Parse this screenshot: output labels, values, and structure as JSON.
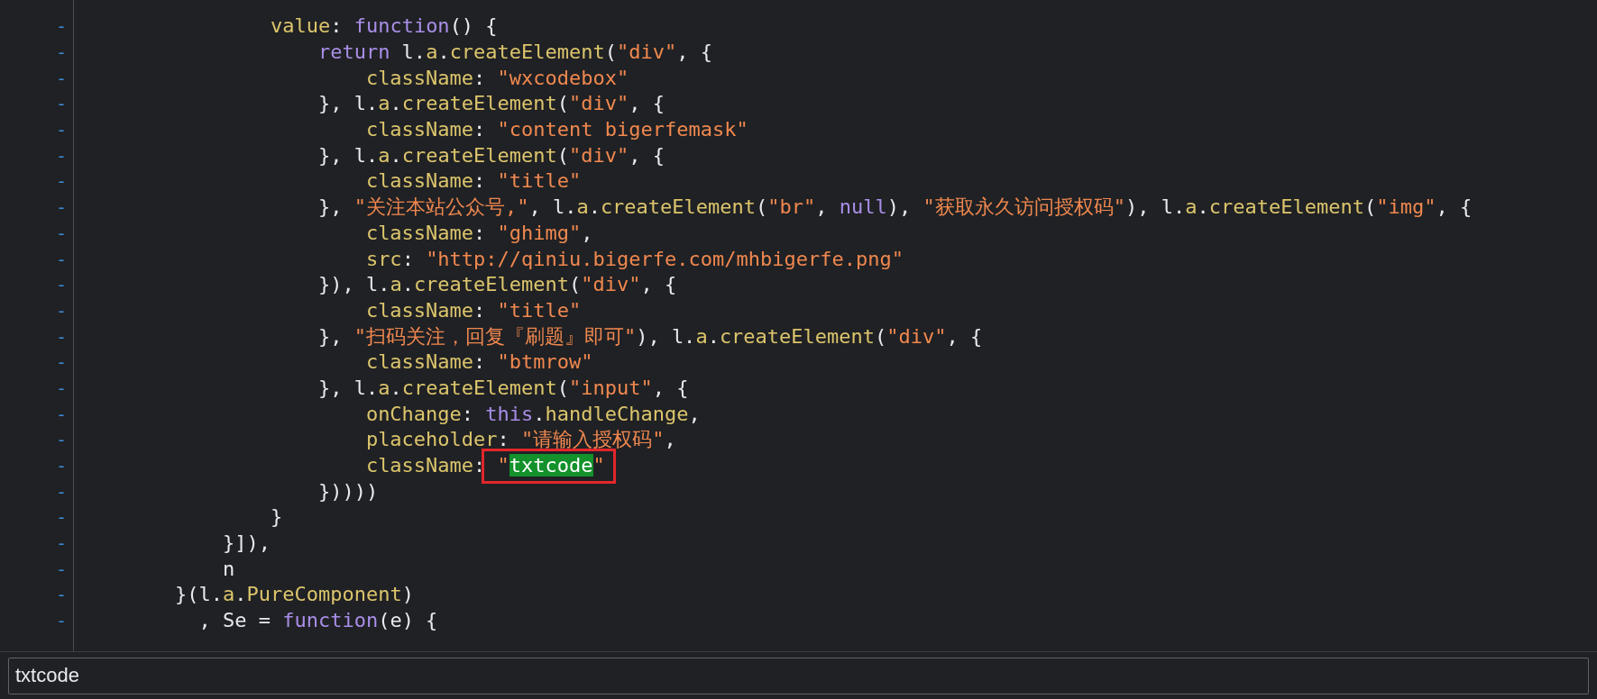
{
  "code_lines": [
    {
      "marker": "-",
      "tokens": [
        {
          "kind": "property",
          "text": "                value"
        },
        {
          "kind": "plain",
          "text": ": "
        },
        {
          "kind": "keyword",
          "text": "function"
        },
        {
          "kind": "plain",
          "text": "() {"
        }
      ]
    },
    {
      "marker": "-",
      "tokens": [
        {
          "kind": "keyword",
          "text": "                    return"
        },
        {
          "kind": "plain",
          "text": " l."
        },
        {
          "kind": "property",
          "text": "a"
        },
        {
          "kind": "plain",
          "text": "."
        },
        {
          "kind": "property",
          "text": "createElement"
        },
        {
          "kind": "plain",
          "text": "("
        },
        {
          "kind": "string",
          "text": "\"div\""
        },
        {
          "kind": "plain",
          "text": ", {"
        }
      ]
    },
    {
      "marker": "-",
      "tokens": [
        {
          "kind": "property",
          "text": "                        className"
        },
        {
          "kind": "plain",
          "text": ": "
        },
        {
          "kind": "string",
          "text": "\"wxcodebox\""
        }
      ]
    },
    {
      "marker": "-",
      "tokens": [
        {
          "kind": "plain",
          "text": "                    }, l."
        },
        {
          "kind": "property",
          "text": "a"
        },
        {
          "kind": "plain",
          "text": "."
        },
        {
          "kind": "property",
          "text": "createElement"
        },
        {
          "kind": "plain",
          "text": "("
        },
        {
          "kind": "string",
          "text": "\"div\""
        },
        {
          "kind": "plain",
          "text": ", {"
        }
      ]
    },
    {
      "marker": "-",
      "tokens": [
        {
          "kind": "property",
          "text": "                        className"
        },
        {
          "kind": "plain",
          "text": ": "
        },
        {
          "kind": "string",
          "text": "\"content bigerfemask\""
        }
      ]
    },
    {
      "marker": "-",
      "tokens": [
        {
          "kind": "plain",
          "text": "                    }, l."
        },
        {
          "kind": "property",
          "text": "a"
        },
        {
          "kind": "plain",
          "text": "."
        },
        {
          "kind": "property",
          "text": "createElement"
        },
        {
          "kind": "plain",
          "text": "("
        },
        {
          "kind": "string",
          "text": "\"div\""
        },
        {
          "kind": "plain",
          "text": ", {"
        }
      ]
    },
    {
      "marker": "-",
      "tokens": [
        {
          "kind": "property",
          "text": "                        className"
        },
        {
          "kind": "plain",
          "text": ": "
        },
        {
          "kind": "string",
          "text": "\"title\""
        }
      ]
    },
    {
      "marker": "-",
      "tokens": [
        {
          "kind": "plain",
          "text": "                    }, "
        },
        {
          "kind": "string",
          "text": "\"关注本站公众号,\""
        },
        {
          "kind": "plain",
          "text": ", l."
        },
        {
          "kind": "property",
          "text": "a"
        },
        {
          "kind": "plain",
          "text": "."
        },
        {
          "kind": "property",
          "text": "createElement"
        },
        {
          "kind": "plain",
          "text": "("
        },
        {
          "kind": "string",
          "text": "\"br\""
        },
        {
          "kind": "plain",
          "text": ", "
        },
        {
          "kind": "keyword",
          "text": "null"
        },
        {
          "kind": "plain",
          "text": "), "
        },
        {
          "kind": "string",
          "text": "\"获取永久访问授权码\""
        },
        {
          "kind": "plain",
          "text": "), l."
        },
        {
          "kind": "property",
          "text": "a"
        },
        {
          "kind": "plain",
          "text": "."
        },
        {
          "kind": "property",
          "text": "createElement"
        },
        {
          "kind": "plain",
          "text": "("
        },
        {
          "kind": "string",
          "text": "\"img\""
        },
        {
          "kind": "plain",
          "text": ", {"
        }
      ]
    },
    {
      "marker": "-",
      "tokens": [
        {
          "kind": "property",
          "text": "                        className"
        },
        {
          "kind": "plain",
          "text": ": "
        },
        {
          "kind": "string",
          "text": "\"ghimg\""
        },
        {
          "kind": "plain",
          "text": ","
        }
      ]
    },
    {
      "marker": "-",
      "tokens": [
        {
          "kind": "property",
          "text": "                        src"
        },
        {
          "kind": "plain",
          "text": ": "
        },
        {
          "kind": "string",
          "text": "\"http://qiniu.bigerfe.com/mhbigerfe.png\""
        }
      ]
    },
    {
      "marker": "-",
      "tokens": [
        {
          "kind": "plain",
          "text": "                    }), l."
        },
        {
          "kind": "property",
          "text": "a"
        },
        {
          "kind": "plain",
          "text": "."
        },
        {
          "kind": "property",
          "text": "createElement"
        },
        {
          "kind": "plain",
          "text": "("
        },
        {
          "kind": "string",
          "text": "\"div\""
        },
        {
          "kind": "plain",
          "text": ", {"
        }
      ]
    },
    {
      "marker": "-",
      "tokens": [
        {
          "kind": "property",
          "text": "                        className"
        },
        {
          "kind": "plain",
          "text": ": "
        },
        {
          "kind": "string",
          "text": "\"title\""
        }
      ]
    },
    {
      "marker": "-",
      "tokens": [
        {
          "kind": "plain",
          "text": "                    }, "
        },
        {
          "kind": "string",
          "text": "\"扫码关注，回复『刷题』即可\""
        },
        {
          "kind": "plain",
          "text": "), l."
        },
        {
          "kind": "property",
          "text": "a"
        },
        {
          "kind": "plain",
          "text": "."
        },
        {
          "kind": "property",
          "text": "createElement"
        },
        {
          "kind": "plain",
          "text": "("
        },
        {
          "kind": "string",
          "text": "\"div\""
        },
        {
          "kind": "plain",
          "text": ", {"
        }
      ]
    },
    {
      "marker": "-",
      "tokens": [
        {
          "kind": "property",
          "text": "                        className"
        },
        {
          "kind": "plain",
          "text": ": "
        },
        {
          "kind": "string",
          "text": "\"btmrow\""
        }
      ]
    },
    {
      "marker": "-",
      "tokens": [
        {
          "kind": "plain",
          "text": "                    }, l."
        },
        {
          "kind": "property",
          "text": "a"
        },
        {
          "kind": "plain",
          "text": "."
        },
        {
          "kind": "property",
          "text": "createElement"
        },
        {
          "kind": "plain",
          "text": "("
        },
        {
          "kind": "string",
          "text": "\"input\""
        },
        {
          "kind": "plain",
          "text": ", {"
        }
      ]
    },
    {
      "marker": "-",
      "tokens": [
        {
          "kind": "property",
          "text": "                        onChange"
        },
        {
          "kind": "plain",
          "text": ": "
        },
        {
          "kind": "keyword",
          "text": "this"
        },
        {
          "kind": "plain",
          "text": "."
        },
        {
          "kind": "property",
          "text": "handleChange"
        },
        {
          "kind": "plain",
          "text": ","
        }
      ]
    },
    {
      "marker": "-",
      "tokens": [
        {
          "kind": "property",
          "text": "                        placeholder"
        },
        {
          "kind": "plain",
          "text": ": "
        },
        {
          "kind": "string",
          "text": "\"请输入授权码\""
        },
        {
          "kind": "plain",
          "text": ","
        }
      ]
    },
    {
      "marker": "-",
      "tokens": [
        {
          "kind": "property",
          "text": "                        className"
        },
        {
          "kind": "plain",
          "text": ": "
        },
        {
          "kind": "box",
          "children": [
            {
              "kind": "string",
              "text": "\""
            },
            {
              "kind": "match",
              "text": "txtcode"
            },
            {
              "kind": "string",
              "text": "\""
            }
          ]
        }
      ]
    },
    {
      "marker": "-",
      "tokens": [
        {
          "kind": "plain",
          "text": "                    }))))"
        }
      ]
    },
    {
      "marker": "-",
      "tokens": [
        {
          "kind": "plain",
          "text": "                }"
        }
      ]
    },
    {
      "marker": "-",
      "tokens": [
        {
          "kind": "plain",
          "text": "            }]),"
        }
      ]
    },
    {
      "marker": "-",
      "tokens": [
        {
          "kind": "plain",
          "text": "            n"
        }
      ]
    },
    {
      "marker": "-",
      "tokens": [
        {
          "kind": "plain",
          "text": "        }(l."
        },
        {
          "kind": "property",
          "text": "a"
        },
        {
          "kind": "plain",
          "text": "."
        },
        {
          "kind": "property",
          "text": "PureComponent"
        },
        {
          "kind": "plain",
          "text": ")"
        }
      ]
    },
    {
      "marker": "-",
      "tokens": [
        {
          "kind": "plain",
          "text": "          , Se = "
        },
        {
          "kind": "keyword",
          "text": "function"
        },
        {
          "kind": "plain",
          "text": "(e) {"
        }
      ]
    }
  ],
  "search": {
    "value": "txtcode"
  }
}
